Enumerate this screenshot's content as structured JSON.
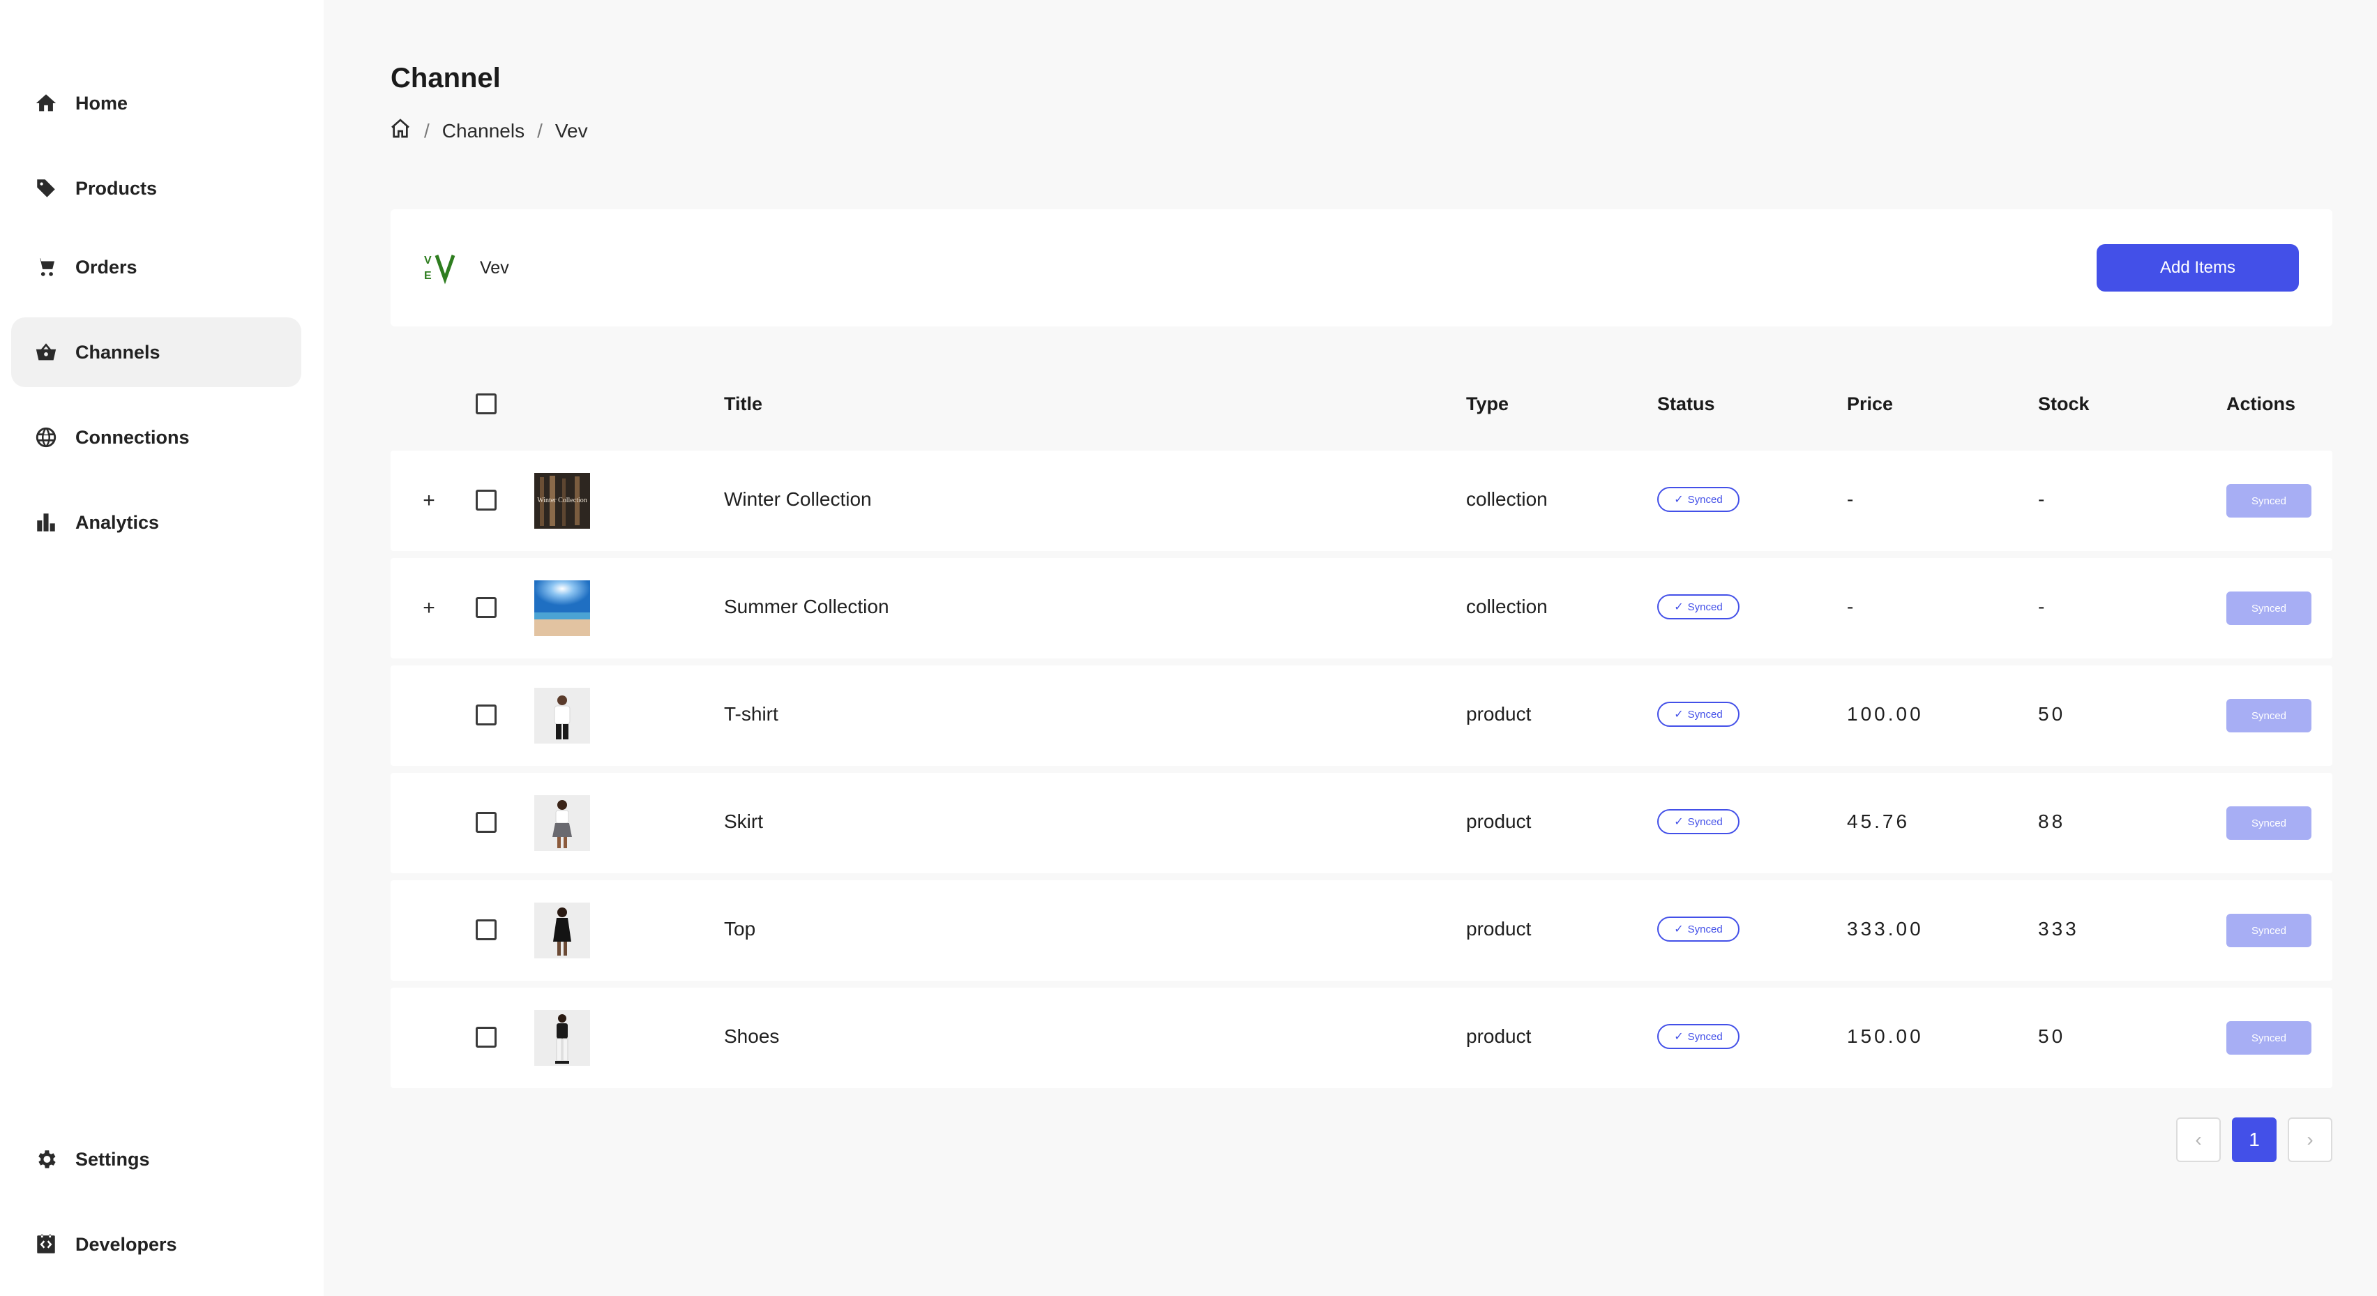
{
  "sidebar": {
    "items": [
      {
        "label": "Home",
        "icon": "home-icon"
      },
      {
        "label": "Products",
        "icon": "tag-icon"
      },
      {
        "label": "Orders",
        "icon": "cart-icon"
      },
      {
        "label": "Channels",
        "icon": "basket-icon",
        "active": true
      },
      {
        "label": "Connections",
        "icon": "globe-icon"
      },
      {
        "label": "Analytics",
        "icon": "bar-chart-icon"
      }
    ],
    "bottom_items": [
      {
        "label": "Settings",
        "icon": "gear-icon"
      },
      {
        "label": "Developers",
        "icon": "code-icon"
      }
    ]
  },
  "page": {
    "title": "Channel",
    "breadcrumb": [
      "Channels",
      "Vev"
    ]
  },
  "channel": {
    "name": "Vev",
    "add_button": "Add Items"
  },
  "table": {
    "headers": {
      "title": "Title",
      "type": "Type",
      "status": "Status",
      "price": "Price",
      "stock": "Stock",
      "actions": "Actions"
    },
    "rows": [
      {
        "title": "Winter Collection",
        "type": "collection",
        "status": "Synced",
        "price": "-",
        "stock": "-",
        "action": "Synced",
        "expandable": true,
        "thumb_text": "Winter Collection"
      },
      {
        "title": "Summer Collection",
        "type": "collection",
        "status": "Synced",
        "price": "-",
        "stock": "-",
        "action": "Synced",
        "expandable": true
      },
      {
        "title": "T-shirt",
        "type": "product",
        "status": "Synced",
        "price": "100.00",
        "stock": "50",
        "action": "Synced"
      },
      {
        "title": "Skirt",
        "type": "product",
        "status": "Synced",
        "price": "45.76",
        "stock": "88",
        "action": "Synced"
      },
      {
        "title": "Top",
        "type": "product",
        "status": "Synced",
        "price": "333.00",
        "stock": "333",
        "action": "Synced"
      },
      {
        "title": "Shoes",
        "type": "product",
        "status": "Synced",
        "price": "150.00",
        "stock": "50",
        "action": "Synced"
      }
    ]
  },
  "pagination": {
    "current": "1"
  },
  "colors": {
    "accent": "#4350e8",
    "action_disabled": "#a7aef4",
    "logo_green": "#2e7d1f"
  }
}
